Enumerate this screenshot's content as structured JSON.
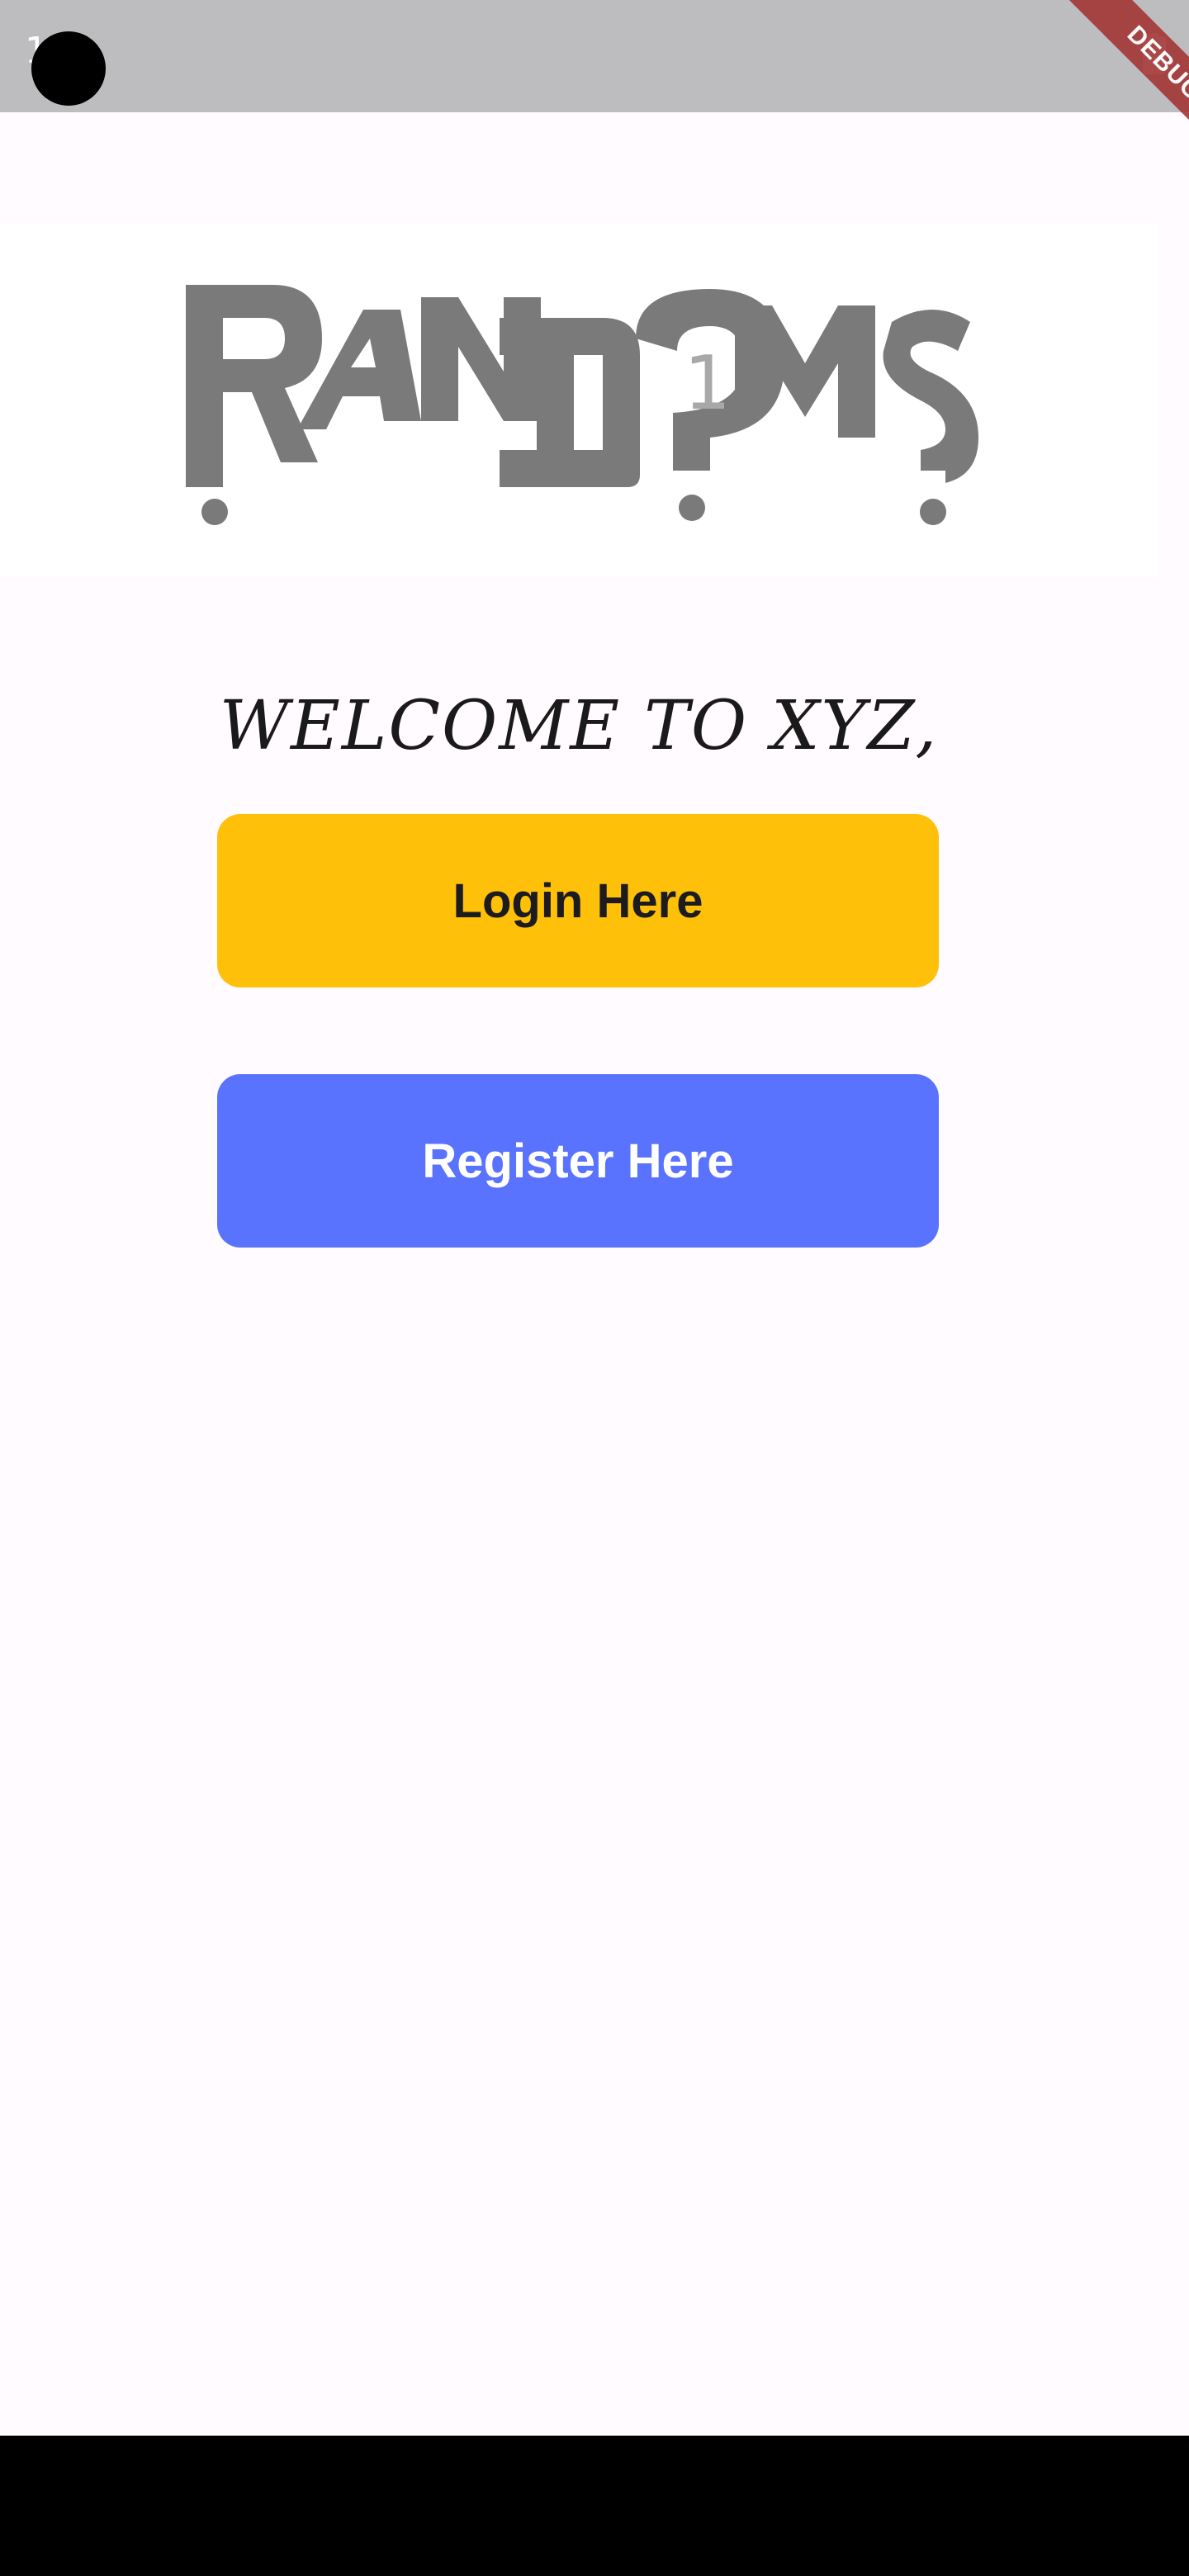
{
  "status_bar": {
    "time": "1 6",
    "debug_label": "DEBUG"
  },
  "logo": {
    "text": "RANDOMS",
    "badge_number": "1",
    "icon": "randoms-logo",
    "color": "#7a7a7a"
  },
  "welcome": {
    "title": "WELCOME TO XYZ,"
  },
  "buttons": {
    "login_label": "Login Here",
    "register_label": "Register Here"
  },
  "colors": {
    "login_bg": "#fec009",
    "register_bg": "#5a73fe",
    "page_bg": "#fffbfe",
    "status_bg": "#bdbcbf"
  }
}
